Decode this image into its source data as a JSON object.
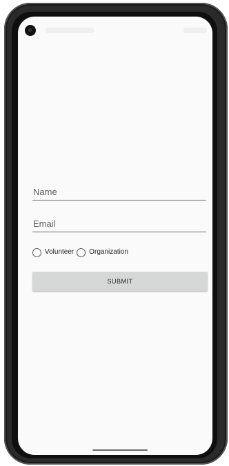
{
  "form": {
    "name_placeholder": "Name",
    "email_placeholder": "Email",
    "radio_options": [
      "Volunteer",
      "Organization"
    ],
    "submit_label": "SUBMIT"
  },
  "icons": {
    "camera": "front-camera-icon",
    "radio": "radio-unchecked-icon"
  },
  "colors": {
    "screen_background": "#fafafa",
    "button_background": "#d6d7d7",
    "underline": "#6a6a6a"
  }
}
